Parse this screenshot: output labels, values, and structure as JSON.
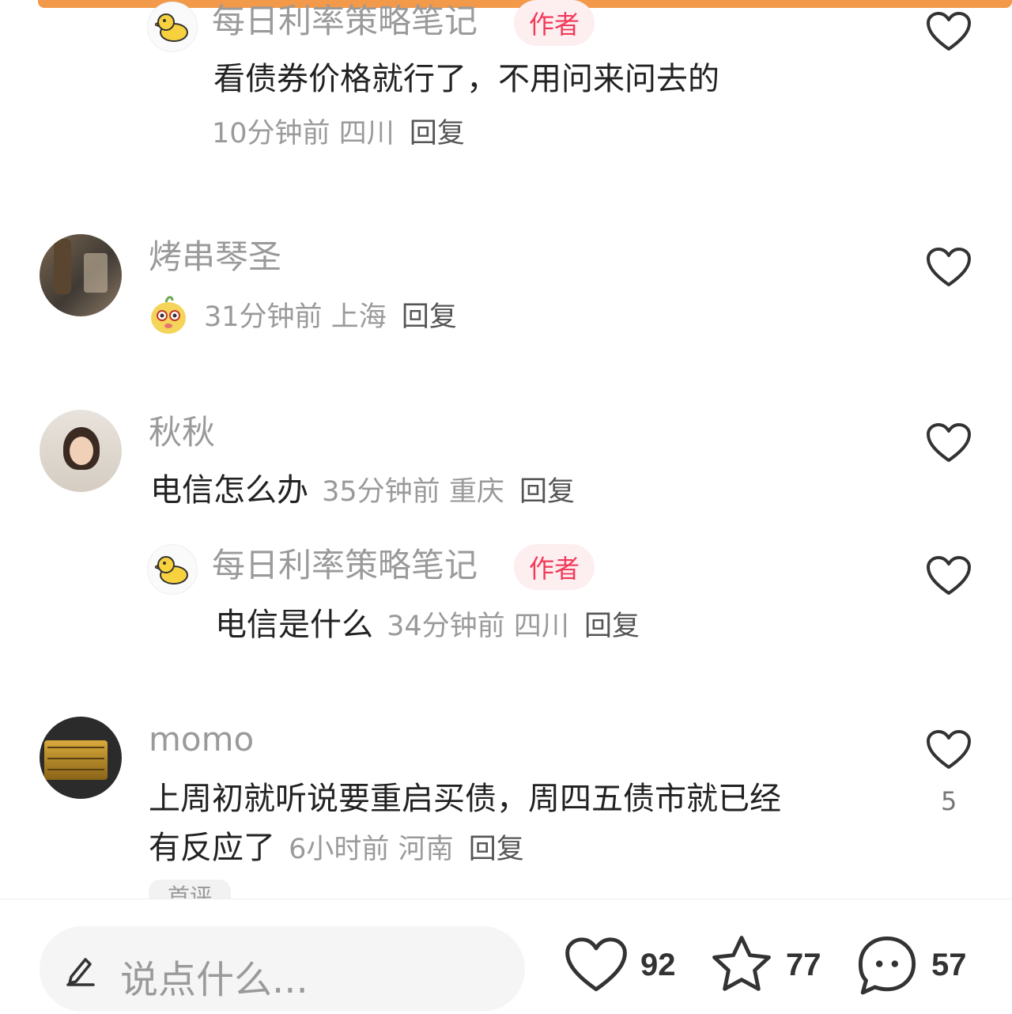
{
  "comments": [
    {
      "author": "每日利率策略笔记",
      "author_tag": "作者",
      "text": "看债券价格就行了，不用问来问去的",
      "time": "10分钟前",
      "location": "四川",
      "reply": "回复"
    },
    {
      "author": "烤串琴圣",
      "text": "",
      "time": "31分钟前",
      "location": "上海",
      "reply": "回复"
    },
    {
      "author": "秋秋",
      "text": "电信怎么办",
      "time": "35分钟前",
      "location": "重庆",
      "reply": "回复"
    },
    {
      "author": "每日利率策略笔记",
      "author_tag": "作者",
      "text": "电信是什么",
      "time": "34分钟前",
      "location": "四川",
      "reply": "回复"
    },
    {
      "author": "momo",
      "text_line1": "上周初就听说要重启买债，周四五债市就已经",
      "text_line2": "有反应了",
      "time": "6小时前",
      "location": "河南",
      "reply": "回复",
      "likes": "5",
      "fold_hint": "首评"
    }
  ],
  "bottom_bar": {
    "placeholder": "说点什么...",
    "likes": "92",
    "favorites": "77",
    "comments": "57"
  },
  "icons": {
    "like": "heart-icon",
    "favorite": "star-icon",
    "comment": "chat-bubble-icon",
    "edit": "pencil-icon",
    "author_avatar": "duck-icon"
  },
  "colors": {
    "accent_bar": "#f2994a",
    "author_tag_text": "#f23a5a",
    "author_tag_bg": "#fdeef0"
  }
}
